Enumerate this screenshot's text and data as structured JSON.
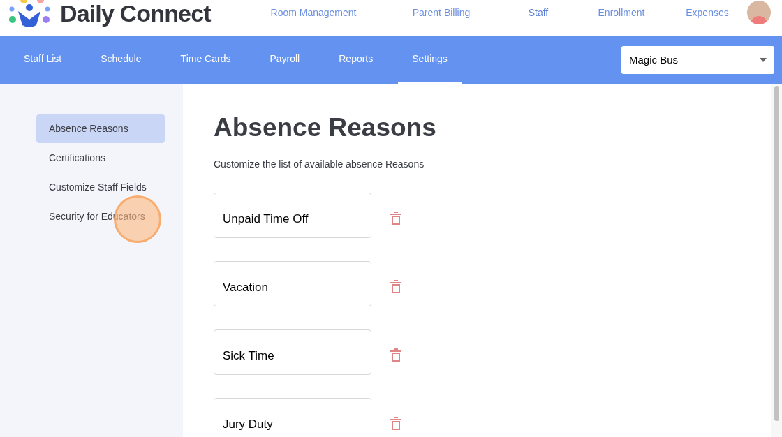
{
  "app": {
    "name": "Daily Connect"
  },
  "top_nav": [
    {
      "label": "Room Management",
      "selected": false
    },
    {
      "label": "Parent Billing",
      "selected": false
    },
    {
      "label": "Staff",
      "selected": true
    },
    {
      "label": "Enrollment",
      "selected": false
    },
    {
      "label": "Expenses",
      "selected": false
    }
  ],
  "tabs": [
    {
      "label": "Staff List",
      "selected": false
    },
    {
      "label": "Schedule",
      "selected": false
    },
    {
      "label": "Time Cards",
      "selected": false
    },
    {
      "label": "Payroll",
      "selected": false
    },
    {
      "label": "Reports",
      "selected": false
    },
    {
      "label": "Settings",
      "selected": true
    }
  ],
  "school_select": {
    "value": "Magic Bus"
  },
  "sidebar": {
    "items": [
      {
        "label": "Absence Reasons",
        "selected": true
      },
      {
        "label": "Certifications",
        "selected": false
      },
      {
        "label": "Customize Staff Fields",
        "selected": false
      },
      {
        "label": "Security for Educators",
        "selected": false
      }
    ]
  },
  "content": {
    "title": "Absence Reasons",
    "description": "Customize the list of available absence Reasons",
    "reasons": [
      {
        "value": "Unpaid Time Off"
      },
      {
        "value": "Vacation"
      },
      {
        "value": "Sick Time"
      },
      {
        "value": "Jury Duty"
      }
    ]
  }
}
